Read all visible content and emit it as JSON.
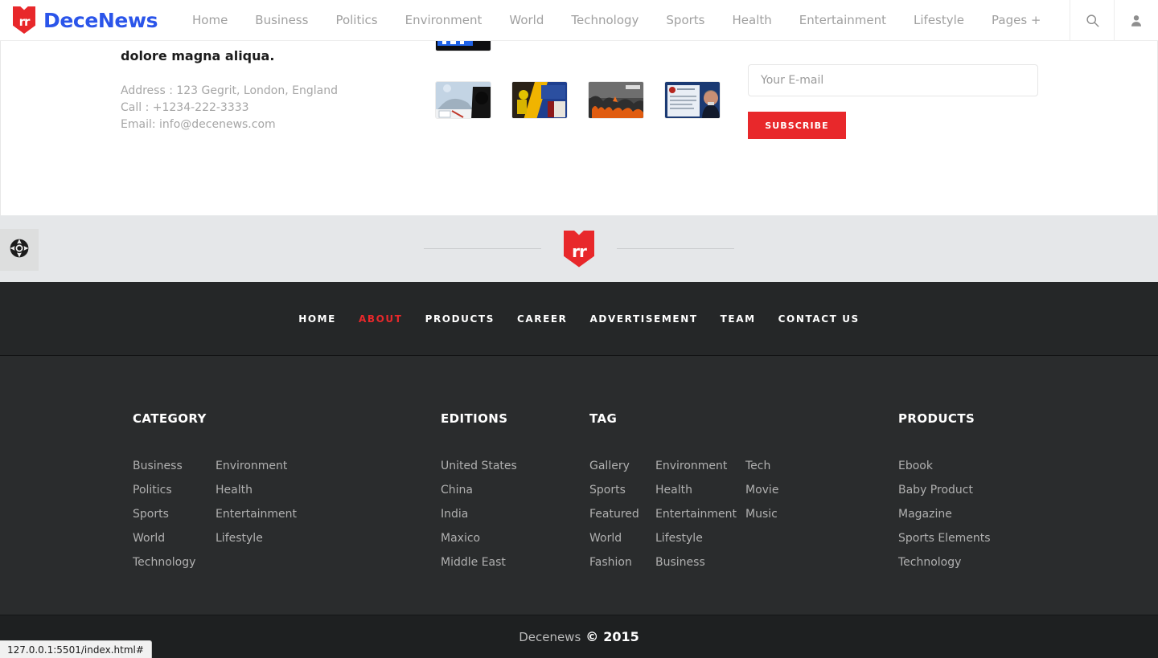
{
  "header": {
    "logo_glyph": "rr",
    "brand": "DeceNews",
    "brand_color": "#2b55ea",
    "accent_color": "#e8282b",
    "nav": [
      {
        "label": "Home"
      },
      {
        "label": "Business"
      },
      {
        "label": "Politics"
      },
      {
        "label": "Environment"
      },
      {
        "label": "World"
      },
      {
        "label": "Technology"
      },
      {
        "label": "Sports"
      },
      {
        "label": "Health"
      },
      {
        "label": "Entertainment"
      },
      {
        "label": "Lifestyle"
      },
      {
        "label": "Pages +"
      }
    ],
    "icons": [
      {
        "name": "search-icon"
      },
      {
        "name": "user-icon"
      }
    ]
  },
  "about": {
    "text_tail": "dolore magna aliqua.",
    "address": "Address : 123 Gegrit, London, England",
    "call": "Call : +1234-222-3333",
    "email": "Email: info@decenews.com"
  },
  "subscribe": {
    "placeholder": "Your E-mail",
    "value": "",
    "button_label": "SUBSCRIBE"
  },
  "logo_strip": {
    "glyph": "rr"
  },
  "dark_nav": {
    "items": [
      {
        "label": "HOME",
        "active": false
      },
      {
        "label": "ABOUT",
        "active": true
      },
      {
        "label": "PRODUCTS",
        "active": false
      },
      {
        "label": "CAREER",
        "active": false
      },
      {
        "label": "ADVERTISEMENT",
        "active": false
      },
      {
        "label": "TEAM",
        "active": false
      },
      {
        "label": "CONTACT US",
        "active": false
      }
    ],
    "active_color": "#e8282b"
  },
  "footer": {
    "columns": [
      {
        "id": "col-category",
        "title": "CATEGORY",
        "lists": [
          [
            "Business",
            "Politics",
            "Sports",
            "World",
            "Technology"
          ],
          [
            "Environment",
            "Health",
            "Entertainment",
            "Lifestyle"
          ]
        ]
      },
      {
        "id": "col-editions",
        "title": "EDITIONS",
        "lists": [
          [
            "United States",
            "China",
            "India",
            "Maxico",
            "Middle East"
          ]
        ]
      },
      {
        "id": "col-tag",
        "title": "TAG",
        "lists": [
          [
            "Gallery",
            "Sports",
            "Featured",
            "World",
            "Fashion"
          ],
          [
            "Environment",
            "Health",
            "Entertainment",
            "Lifestyle",
            "Business"
          ],
          [
            "Tech",
            "Movie",
            "Music"
          ]
        ]
      },
      {
        "id": "col-products",
        "title": "PRODUCTS",
        "lists": [
          [
            "Ebook",
            "Baby Product",
            "Magazine",
            "Sports Elements",
            "Technology"
          ]
        ]
      }
    ]
  },
  "copyright": {
    "name": "Decenews",
    "symbol": "©",
    "year": "2015"
  },
  "support_widget": {
    "icon": "lifebuoy-icon"
  },
  "status_bar": {
    "url": "127.0.0.1:5501/index.html#"
  }
}
